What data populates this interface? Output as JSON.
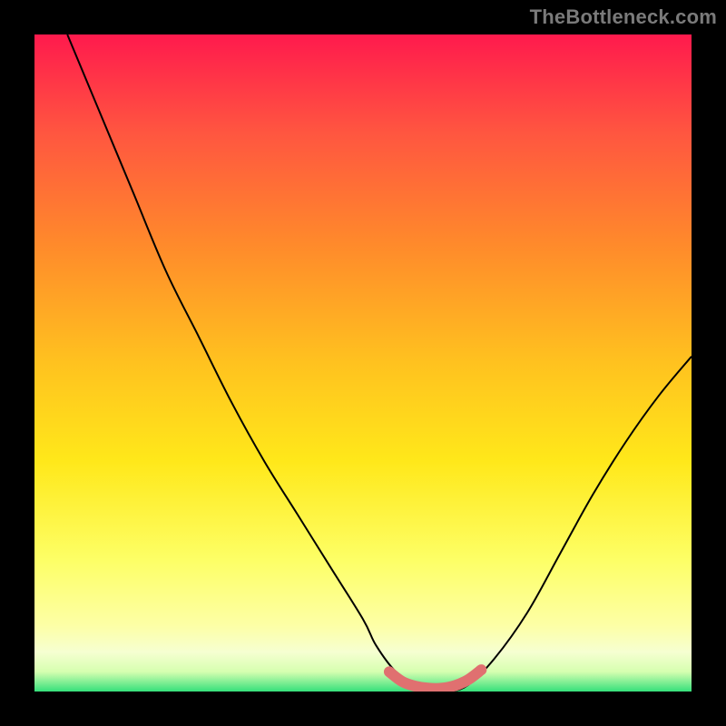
{
  "watermark": "TheBottleneck.com",
  "palette": {
    "black": "#000000",
    "grad_top": "#ff1a4d",
    "grad_1": "#ff5640",
    "grad_2": "#ff8a2b",
    "grad_3": "#ffc21f",
    "grad_4": "#ffe81a",
    "grad_5": "#fdff66",
    "grad_6": "#fdffa6",
    "grad_7": "#f6ffd1",
    "grad_8": "#d6ffb0",
    "grad_bottom": "#35e07b",
    "curve": "#000000",
    "marker": "#e07070"
  },
  "chart_data": {
    "type": "line",
    "title": "",
    "xlabel": "",
    "ylabel": "",
    "xlim": [
      0,
      100
    ],
    "ylim": [
      0,
      100
    ],
    "series": [
      {
        "name": "bottleneck-curve",
        "x": [
          5,
          10,
          15,
          20,
          25,
          30,
          35,
          40,
          45,
          50,
          52,
          55,
          58,
          60,
          63,
          66,
          70,
          75,
          80,
          85,
          90,
          95,
          100
        ],
        "y": [
          100,
          88,
          76,
          64,
          54,
          44,
          35,
          27,
          19,
          11,
          7,
          3,
          1,
          0,
          0,
          1,
          5,
          12,
          21,
          30,
          38,
          45,
          51
        ]
      },
      {
        "name": "optimal-range",
        "x": [
          54,
          56,
          58,
          60,
          62,
          64,
          66,
          68
        ],
        "y": [
          3,
          1.5,
          0.8,
          0.5,
          0.5,
          0.9,
          1.8,
          3.3
        ]
      }
    ],
    "background_gradient": {
      "direction": "vertical",
      "stops": [
        {
          "offset": 0.0,
          "color": "#ff1a4d"
        },
        {
          "offset": 0.15,
          "color": "#ff5640"
        },
        {
          "offset": 0.32,
          "color": "#ff8a2b"
        },
        {
          "offset": 0.5,
          "color": "#ffc21f"
        },
        {
          "offset": 0.65,
          "color": "#ffe81a"
        },
        {
          "offset": 0.8,
          "color": "#fdff66"
        },
        {
          "offset": 0.9,
          "color": "#fdffa6"
        },
        {
          "offset": 0.94,
          "color": "#f6ffd1"
        },
        {
          "offset": 0.97,
          "color": "#d6ffb0"
        },
        {
          "offset": 1.0,
          "color": "#35e07b"
        }
      ]
    }
  }
}
